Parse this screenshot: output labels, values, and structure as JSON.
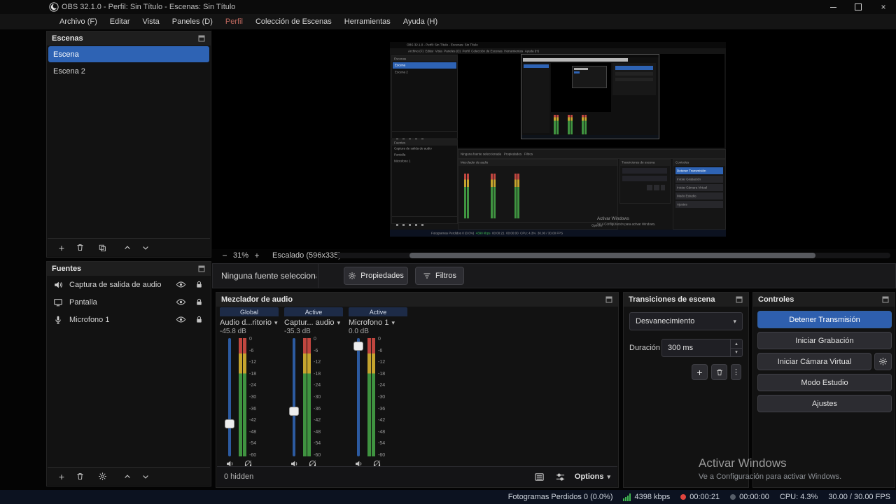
{
  "colors": {
    "selection_blue": "#2e63b4",
    "accent_button_blue": "#2e5fae",
    "meter_red": "#c0463f",
    "meter_yellow": "#c5a42e",
    "meter_green": "#3f9340",
    "bitrate_green": "#3fb950",
    "live_red": "#e0443e",
    "statusbar_bg": "#0c1220"
  },
  "icons": {
    "caret_down": "▾",
    "spin_up": "▴",
    "spin_down": "▾",
    "plus": "+",
    "minus": "−",
    "dots_vertical": "⋮",
    "close": "×"
  },
  "titlebar": {
    "title": "OBS 32.1.0 - Perfil: Sin Título - Escenas: Sin Título"
  },
  "menubar": {
    "items": [
      "Archivo (F)",
      "Editar",
      "Vista",
      "Paneles (D)",
      "Perfil",
      "Colección de Escenas",
      "Herramientas",
      "Ayuda (H)"
    ]
  },
  "scenes": {
    "title": "Escenas",
    "items": [
      "Escena",
      "Escena 2"
    ]
  },
  "sources": {
    "title": "Fuentes",
    "items": [
      {
        "label": "Captura de salida de audio",
        "icon": "speaker-icon"
      },
      {
        "label": "Pantalla",
        "icon": "monitor-icon"
      },
      {
        "label": "Microfono 1",
        "icon": "microphone-icon"
      }
    ]
  },
  "preview": {
    "zoom_level": "31%",
    "scale_label": "Escalado (596x335)"
  },
  "source_toolbar": {
    "no_source_label": "Ninguna fuente seleccionada",
    "properties_label": "Propiedades",
    "filters_label": "Filtros"
  },
  "mixer": {
    "title": "Mezclador de audio",
    "channels": [
      {
        "state": "Global",
        "name": "Audio d...ritorio",
        "db": "-45.8 dB"
      },
      {
        "state": "Active",
        "name": "Captur... audio",
        "db": "-35.3 dB"
      },
      {
        "state": "Active",
        "name": "Microfono 1",
        "db": "0.0 dB"
      }
    ],
    "scale": [
      "0",
      "-6",
      "-12",
      "-18",
      "-24",
      "-30",
      "-36",
      "-42",
      "-48",
      "-54",
      "-60"
    ],
    "hidden_label": "0 hidden",
    "options_label": "Options"
  },
  "transitions": {
    "title": "Transiciones de escena",
    "selected": "Desvanecimiento",
    "duration_label": "Duración",
    "duration_value": "300 ms"
  },
  "controls": {
    "title": "Controles",
    "stop_stream": "Detener Transmisión",
    "start_recording": "Iniciar Grabación",
    "start_vcam": "Iniciar Cámara Virtual",
    "studio_mode": "Modo Estudio",
    "settings": "Ajustes"
  },
  "watermark": {
    "line1": "Activar Windows",
    "line2": "Ve a Configuración para activar Windows."
  },
  "statusbar": {
    "dropped_frames": "Fotogramas Perdidos 0 (0.0%)",
    "bitrate": "4398 kbps",
    "stream_time": "00:00:21",
    "record_time": "00:00:00",
    "cpu": "CPU: 4.3%",
    "fps": "30.00 / 30.00 FPS"
  }
}
